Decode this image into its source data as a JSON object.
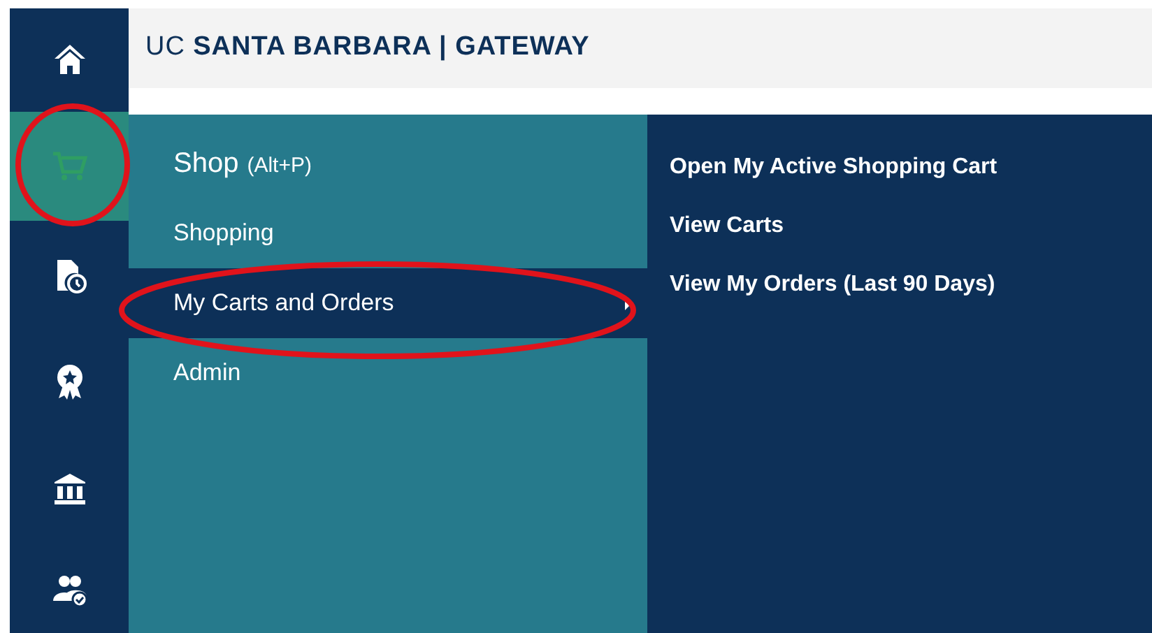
{
  "header": {
    "title": "UC **SANTA BARBARA | GATEWAY**"
  },
  "sidebar": {
    "items": [
      {
        "selected": false
      },
      {
        "selected": true
      },
      {
        "selected": false
      },
      {
        "selected": false
      },
      {
        "selected": false
      },
      {
        "selected": false
      }
    ]
  },
  "menu": {
    "title": "Shop",
    "shortcut": "(Alt+P)",
    "items": [
      {
        "label": "Shopping",
        "selected": false,
        "has_submenu": false
      },
      {
        "label": "My Carts and Orders",
        "selected": true,
        "has_submenu": true
      },
      {
        "label": "Admin",
        "selected": false,
        "has_submenu": false
      }
    ]
  },
  "submenu": {
    "items": [
      "Open My Active Shopping Cart",
      "View Carts",
      "View My Orders (Last 90 Days)"
    ]
  }
}
